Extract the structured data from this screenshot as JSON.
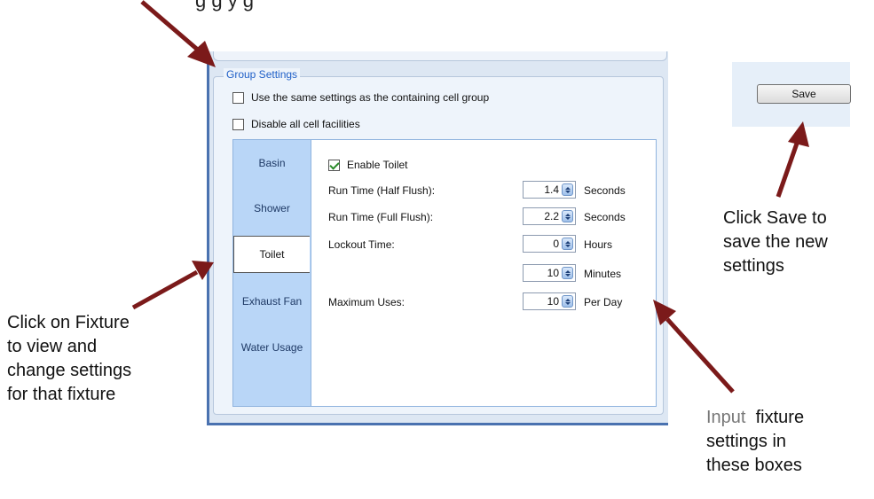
{
  "top_caption": "g    g  y      g",
  "group_settings": {
    "legend": "Group Settings",
    "same_settings_label": "Use the same settings as the containing cell group",
    "disable_facilities_label": "Disable all cell facilities"
  },
  "tabs": [
    "Basin",
    "Shower",
    "Toilet",
    "Exhaust Fan",
    "Water Usage"
  ],
  "selected_tab": "Toilet",
  "toilet": {
    "enable_label": "Enable Toilet",
    "enable_checked": true,
    "rows": [
      {
        "label": "Run Time (Half Flush):",
        "value": "1.4",
        "unit": "Seconds"
      },
      {
        "label": "Run Time (Full Flush):",
        "value": "2.2",
        "unit": "Seconds"
      },
      {
        "label": "Lockout Time:",
        "value": "0",
        "unit": "Hours"
      },
      {
        "label": "",
        "value": "10",
        "unit": "Minutes"
      },
      {
        "label": "Maximum Uses:",
        "value": "10",
        "unit": "Per Day"
      }
    ]
  },
  "save_label": "Save",
  "annotations": {
    "fixture_note": [
      "Click on Fixture",
      "to view and",
      "change settings",
      "for that fixture"
    ],
    "save_note": [
      "Click Save to",
      "save the new",
      "settings"
    ],
    "input_note_gray": "Input",
    "input_note": [
      "fixture",
      "settings in",
      "these boxes"
    ]
  },
  "colors": {
    "arrow": "#7b1a1a",
    "tab_background": "#b9d6f7",
    "legend_text": "#1f5fc7"
  }
}
